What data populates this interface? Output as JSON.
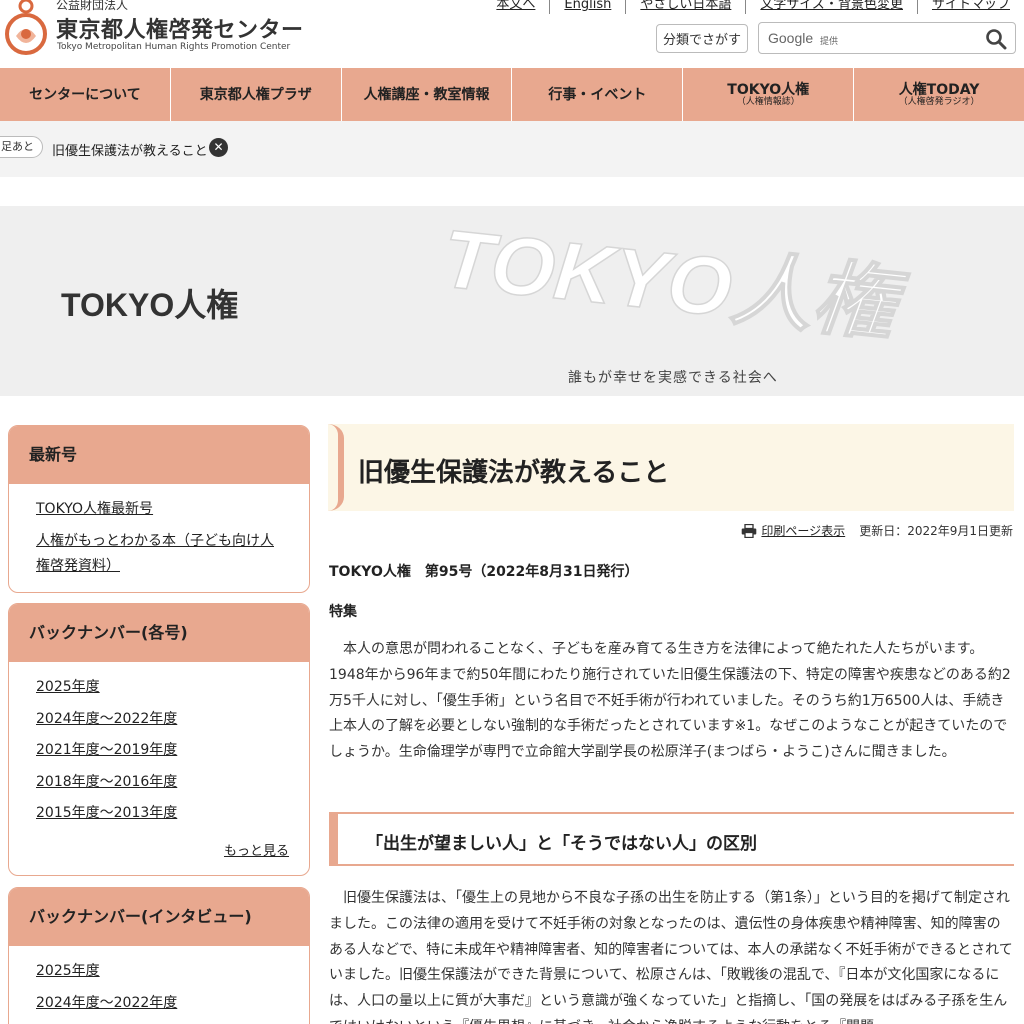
{
  "header": {
    "org_type": "公益財団法人",
    "org_name": "東京都人権啓発センター",
    "org_name_en": "Tokyo Metropolitan Human Rights Promotion Center",
    "util_links": [
      "本文へ",
      "English",
      "やさしい日本語",
      "文字サイズ・背景色変更",
      "サイトマップ"
    ],
    "category_button": "分類でさがす",
    "search_logo": "Google",
    "search_sub": "提供"
  },
  "nav": {
    "items": [
      {
        "label": "センターについて",
        "sub": ""
      },
      {
        "label": "東京都人権プラザ",
        "sub": ""
      },
      {
        "label": "人権講座・教室情報",
        "sub": ""
      },
      {
        "label": "行事・イベント",
        "sub": ""
      },
      {
        "label": "TOKYO人権",
        "sub": "（人権情報誌）"
      },
      {
        "label": "人権TODAY",
        "sub": "（人権啓発ラジオ）"
      }
    ]
  },
  "breadcrumb": {
    "tag": "足あと",
    "current": "旧優生保護法が教えること",
    "close": "✕"
  },
  "hero": {
    "title": "TOKYO人権",
    "art_text": "TOKYO人権",
    "tagline": "誰もが幸せを実感できる社会へ"
  },
  "sidebar": {
    "latest": {
      "title": "最新号",
      "links": [
        "TOKYO人権最新号",
        "人権がもっとわかる本（子ども向け人",
        "権啓発資料）"
      ]
    },
    "backnumber_issue": {
      "title": "バックナンバー(各号)",
      "links": [
        "2025年度",
        "2024年度～2022年度",
        "2021年度～2019年度",
        "2018年度～2016年度",
        "2015年度～2013年度"
      ],
      "more": "もっと見る"
    },
    "backnumber_interview": {
      "title": "バックナンバー(インタビュー)",
      "links": [
        "2025年度",
        "2024年度～2022年度"
      ]
    }
  },
  "article": {
    "title": "旧優生保護法が教えること",
    "print_label": "印刷ページ表示",
    "updated": "更新日：2022年9月1日更新",
    "issue": "TOKYO人権　第95号（2022年8月31日発行）",
    "feature": "特集",
    "para1": "本人の意思が問われることなく、子どもを産み育てる生き方を法律によって絶たれた人たちがいます。1948年から96年まで約50年間にわたり施行されていた旧優生保護法の下、特定の障害や疾患などのある約2万5千人に対し、「優生手術」という名目で不妊手術が行われていました。そのうち約1万6500人は、手続き上本人の了解を必要としない強制的な手術だったとされています※1。なぜこのようなことが起きていたのでしょうか。生命倫理学が専門で立命館大学副学長の松原洋子(まつばら・ようこ)さんに聞きました。",
    "section1": "「出生が望ましい人」と「そうではない人」の区別",
    "para2": "旧優生保護法は、「優生上の見地から不良な子孫の出生を防止する（第1条）」という目的を掲げて制定されました。この法律の適用を受けて不妊手術の対象となったのは、遺伝性の身体疾患や精神障害、知的障害のある人などで、特に未成年や精神障害者、知的障害者については、本人の承諾なく不妊手術ができるとされていました。旧優生保護法ができた背景について、松原さんは、「敗戦後の混乱で、『日本が文化国家になるには、人口の量以上に質が大事だ』という意識が強くなっていた」と指摘し、「国の発展をはばみる子孫を生んではいけないという『優生思想』に基づき、社会から逸脱するような行動をとる『問題"
  },
  "colors": {
    "accent": "#e8a88f",
    "title_bg": "#fcf6e6",
    "crumb_bg": "#f3f3f3",
    "hero_bg": "#efefef"
  }
}
